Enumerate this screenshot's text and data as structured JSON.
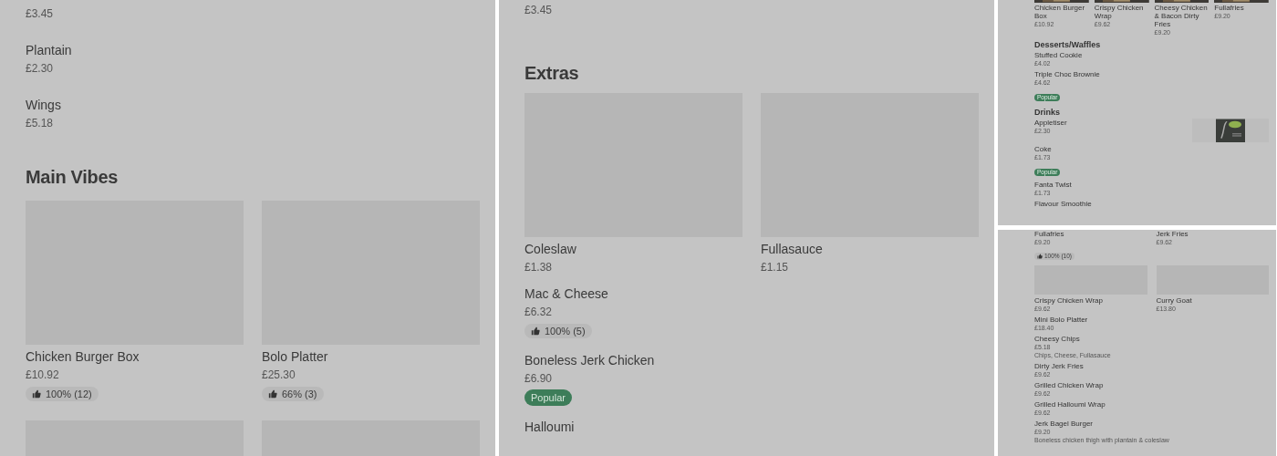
{
  "panels": [
    {
      "kind": "page",
      "blocks": [
        {
          "kind": "item",
          "price": "£3.45"
        },
        {
          "kind": "item",
          "name": "Plantain",
          "price": "£2.30"
        },
        {
          "kind": "item",
          "name": "Wings",
          "price": "£5.18"
        },
        {
          "kind": "heading",
          "text": "Main Vibes"
        },
        {
          "kind": "card-grid",
          "items": [
            {
              "kind": "card",
              "name": "Chicken Burger Box",
              "price": "£10.92",
              "rating": "100% (12)"
            },
            {
              "kind": "card",
              "name": "Bolo Platter",
              "price": "£25.30",
              "rating": "66% (3)"
            }
          ]
        },
        {
          "kind": "card-grid",
          "items": [
            {
              "kind": "card"
            },
            {
              "kind": "card"
            }
          ]
        }
      ]
    },
    {
      "kind": "page",
      "blocks": [
        {
          "kind": "item",
          "price": "£3.45"
        },
        {
          "kind": "heading",
          "text": "Extras"
        },
        {
          "kind": "card-grid",
          "items": [
            {
              "kind": "card",
              "name": "Coleslaw",
              "price": "£1.38"
            },
            {
              "kind": "card",
              "name": "Fullasauce",
              "price": "£1.15"
            }
          ]
        },
        {
          "kind": "item",
          "name": "Mac & Cheese",
          "price": "£6.32",
          "rating": "100% (5)"
        },
        {
          "kind": "item",
          "name": "Boneless Jerk Chicken",
          "price": "£6.90",
          "badge": "Popular"
        },
        {
          "kind": "item",
          "name": "Halloumi"
        }
      ]
    },
    {
      "kind": "mini",
      "blocks": [
        {
          "kind": "photo-grid",
          "items": [
            {
              "kind": "card",
              "name": "Chicken Burger Box",
              "price": "£10.92"
            },
            {
              "kind": "card",
              "name": "Crispy Chicken Wrap",
              "price": "£9.62"
            },
            {
              "kind": "card",
              "name": "Cheesy Chicken & Bacon Dirty Fries",
              "price": "£9.20"
            },
            {
              "kind": "card",
              "name": "Fullafries",
              "price": "£9.20"
            }
          ]
        },
        {
          "kind": "heading",
          "text": "Desserts/Waffles"
        },
        {
          "kind": "item",
          "name": "Stuffed Cookie",
          "price": "£4.02"
        },
        {
          "kind": "item",
          "name": "Triple Choc Brownie",
          "price": "£4.62",
          "badge": "Popular"
        },
        {
          "kind": "heading",
          "text": "Drinks"
        },
        {
          "kind": "photo-item",
          "name": "Appletiser",
          "price": "£2.30"
        },
        {
          "kind": "item",
          "name": "Coke",
          "price": "£1.73",
          "badge": "Popular"
        },
        {
          "kind": "item",
          "name": "Fanta Twist",
          "price": "£1.73"
        },
        {
          "kind": "item",
          "name": "Flavour Smoothie"
        }
      ]
    },
    {
      "kind": "mini",
      "blocks": [
        {
          "kind": "text-grid",
          "items": [
            {
              "kind": "card",
              "name": "Fullafries",
              "price": "£9.20",
              "rating": "100% (10)"
            },
            {
              "kind": "card",
              "name": "Jerk Fries",
              "price": "£9.62"
            }
          ]
        },
        {
          "kind": "card-grid",
          "items": [
            {
              "kind": "card",
              "name": "Crispy Chicken Wrap",
              "price": "£9.62"
            },
            {
              "kind": "card",
              "name": "Curry Goat",
              "price": "£13.80"
            }
          ]
        },
        {
          "kind": "item",
          "name": "Mini Bolo Platter",
          "price": "£18.40"
        },
        {
          "kind": "item",
          "name": "Cheesy Chips",
          "price": "£5.18",
          "description": "Chips, Cheese, Fullasauce"
        },
        {
          "kind": "item",
          "name": "Dirty Jerk Fries",
          "price": "£9.62"
        },
        {
          "kind": "item",
          "name": "Grilled Chicken Wrap",
          "price": "£9.62"
        },
        {
          "kind": "item",
          "name": "Grilled Halloumi Wrap",
          "price": "£9.62"
        },
        {
          "kind": "item",
          "name": "Jerk Bagel Burger",
          "price": "£9.20",
          "description": "Boneless chicken thigh with plantain & coleslaw"
        }
      ]
    }
  ]
}
